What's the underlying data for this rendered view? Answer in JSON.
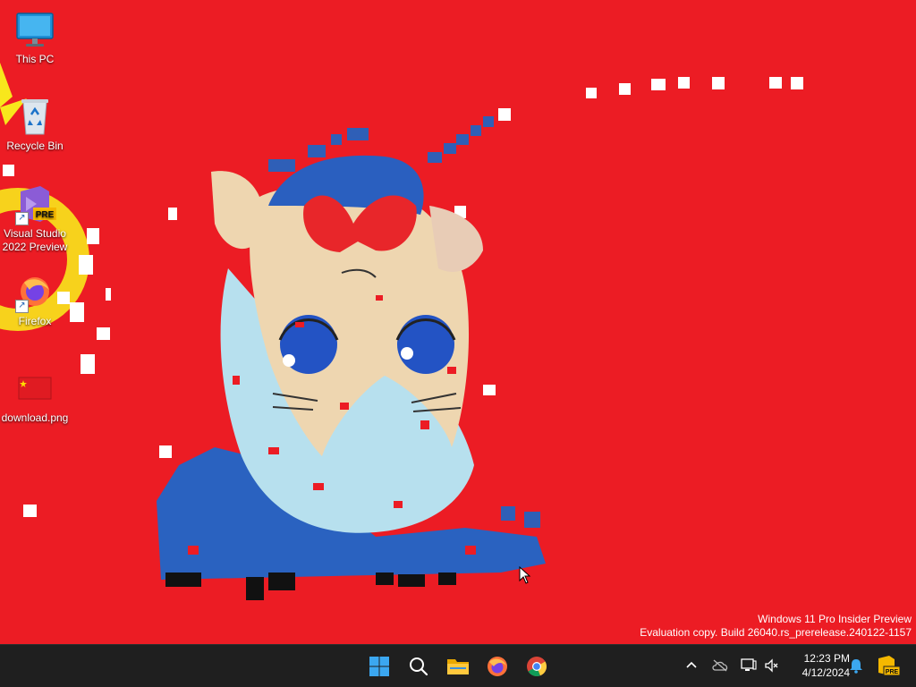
{
  "desktop": {
    "background_color": "#ec1c24",
    "icons": [
      {
        "label": "This PC",
        "icon": "monitor-icon"
      },
      {
        "label": "Recycle Bin",
        "icon": "recycle-bin-icon"
      },
      {
        "label": "Visual Studio 2022 Preview",
        "icon": "visual-studio-icon",
        "badge": "PRE"
      },
      {
        "label": "Firefox",
        "icon": "firefox-icon"
      },
      {
        "label": "download.png",
        "icon": "image-file-icon"
      }
    ]
  },
  "watermark": {
    "line1": "Windows 11 Pro Insider Preview",
    "line2": "Evaluation copy. Build 26040.rs_prerelease.240122-1157"
  },
  "taskbar": {
    "background_color": "#1f1f1f",
    "pinned": [
      {
        "name": "Start",
        "icon": "windows-start-icon"
      },
      {
        "name": "Search",
        "icon": "search-icon"
      },
      {
        "name": "File Explorer",
        "icon": "folder-icon"
      },
      {
        "name": "Firefox",
        "icon": "firefox-icon"
      },
      {
        "name": "Chrome",
        "icon": "chrome-icon"
      }
    ],
    "tray": {
      "icons": [
        "chevron-up-icon",
        "onedrive-icon",
        "network-icon",
        "speaker-muted-icon",
        "notification-bell-icon",
        "insider-badge-icon"
      ],
      "time": "12:23 PM",
      "date": "4/12/2024",
      "insider_badge": "PRE"
    }
  }
}
